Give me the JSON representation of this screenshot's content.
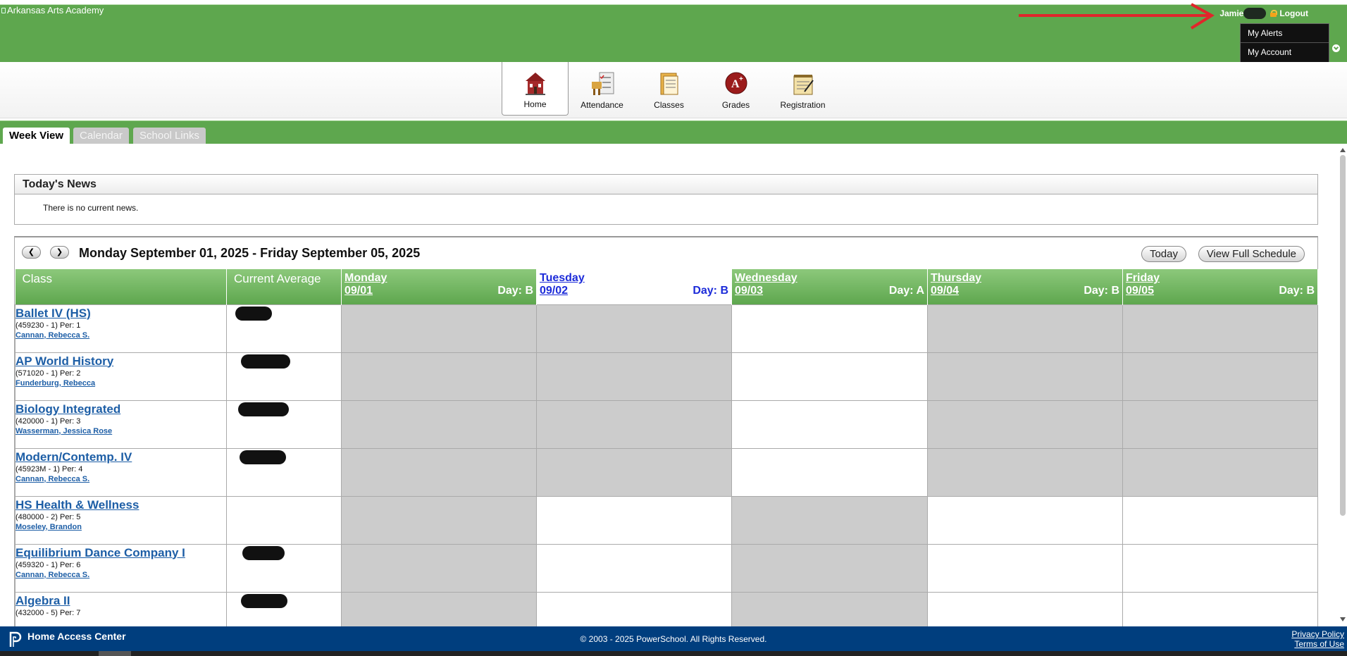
{
  "header": {
    "school_name": "Arkansas Arts Academy",
    "user_name": "Jamie",
    "logout_label": "Logout",
    "account_menu": [
      "My Alerts",
      "My Account"
    ]
  },
  "nav": {
    "items": [
      {
        "label": "Home",
        "icon": "home-icon",
        "active": true
      },
      {
        "label": "Attendance",
        "icon": "attendance-icon"
      },
      {
        "label": "Classes",
        "icon": "classes-icon"
      },
      {
        "label": "Grades",
        "icon": "grades-icon"
      },
      {
        "label": "Registration",
        "icon": "registration-icon"
      }
    ]
  },
  "tabs": [
    {
      "label": "Week View",
      "active": true
    },
    {
      "label": "Calendar"
    },
    {
      "label": "School Links"
    }
  ],
  "news": {
    "title": "Today's News",
    "body": "There is no current news."
  },
  "week": {
    "range": "Monday September 01, 2025 - Friday September 05, 2025",
    "today_label": "Today",
    "full_schedule_label": "View Full Schedule",
    "prev_icon": "chevron-left-icon",
    "next_icon": "chevron-right-icon",
    "columns": {
      "class": "Class",
      "average": "Current Average"
    },
    "days": [
      {
        "name": "Monday",
        "date": "09/01",
        "code": "Day: B"
      },
      {
        "name": "Tuesday",
        "date": "09/02",
        "code": "Day: B",
        "today": true
      },
      {
        "name": "Wednesday",
        "date": "09/03",
        "code": "Day: A"
      },
      {
        "name": "Thursday",
        "date": "09/04",
        "code": "Day: B"
      },
      {
        "name": "Friday",
        "date": "09/05",
        "code": "Day: B"
      }
    ],
    "classes": [
      {
        "name": "Ballet IV (HS)",
        "section": "(459230 - 1) Per: 1",
        "teacher": "Cannan, Rebecca S.",
        "average_redacted": true,
        "grey_days": [
          0,
          1,
          3,
          4
        ]
      },
      {
        "name": "AP World History",
        "section": "(571020 - 1) Per: 2",
        "teacher": "Funderburg, Rebecca",
        "average_redacted": true,
        "grey_days": [
          0,
          1,
          3,
          4
        ]
      },
      {
        "name": "Biology Integrated",
        "section": "(420000 - 1) Per: 3",
        "teacher": "Wasserman, Jessica Rose",
        "average_redacted": true,
        "grey_days": [
          0,
          1,
          3,
          4
        ]
      },
      {
        "name": "Modern/Contemp. IV",
        "section": "(45923M - 1) Per: 4",
        "teacher": "Cannan, Rebecca S.",
        "average_redacted": true,
        "grey_days": [
          0,
          1,
          3,
          4
        ]
      },
      {
        "name": "HS Health & Wellness",
        "section": "(480000 - 2) Per: 5",
        "teacher": "Moseley, Brandon",
        "average_redacted": false,
        "grey_days": [
          0,
          2
        ]
      },
      {
        "name": "Equilibrium Dance Company I",
        "section": "(459320 - 1) Per: 6",
        "teacher": "Cannan, Rebecca S.",
        "average_redacted": true,
        "grey_days": [
          0,
          2
        ]
      },
      {
        "name": "Algebra II",
        "section": "(432000 - 5) Per: 7",
        "teacher": "",
        "average_redacted": true,
        "grey_days": [
          0,
          2
        ]
      }
    ]
  },
  "footer": {
    "app_name": "Home Access Center",
    "copyright": "© 2003 - 2025 PowerSchool. All Rights Reserved.",
    "privacy": "Privacy Policy",
    "terms": "Terms of Use"
  },
  "colors": {
    "header_green": "#5ea74e",
    "footer_blue": "#003e7e",
    "link_blue": "#1d5ea6",
    "today_blue": "#1c2bd9",
    "annotation_red": "#e0262b"
  }
}
